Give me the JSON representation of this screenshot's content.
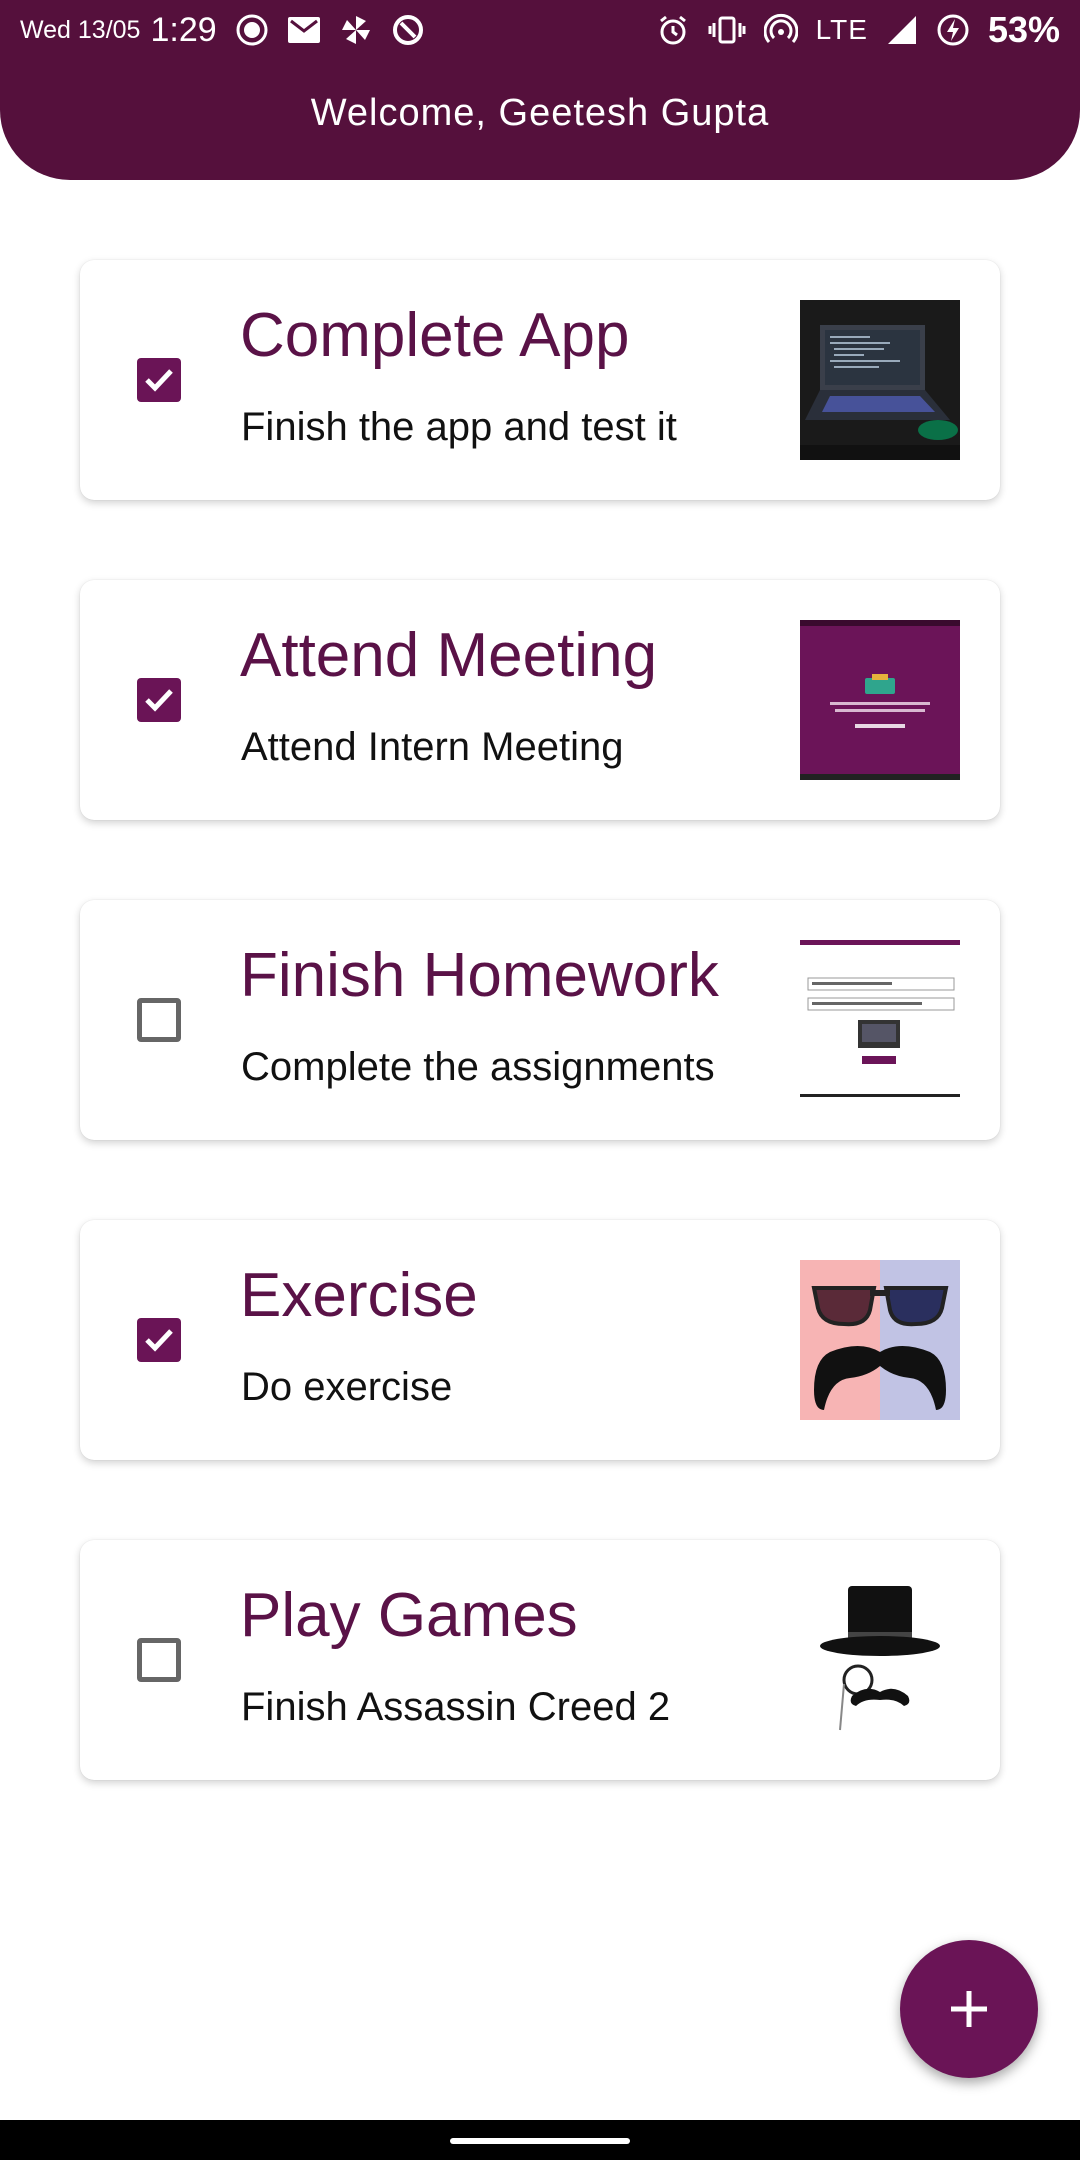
{
  "status_bar": {
    "date": "Wed 13/05",
    "time": "1:29",
    "network": "LTE",
    "battery": "53%",
    "icons_left": [
      "record-icon",
      "gmail-icon",
      "pinwheel-icon",
      "app-icon"
    ],
    "icons_right": [
      "alarm-icon",
      "vibrate-icon",
      "hotspot-icon",
      "signal-icon",
      "battery-saver-icon"
    ]
  },
  "header": {
    "welcome": "Welcome, Geetesh Gupta",
    "color": "#55103c"
  },
  "tasks": [
    {
      "title": "Complete App",
      "description": "Finish the app and test it",
      "checked": true,
      "thumbnail": "laptop-photo"
    },
    {
      "title": "Attend Meeting",
      "description": "Attend Intern Meeting",
      "checked": true,
      "thumbnail": "app-screenshot-purple"
    },
    {
      "title": "Finish Homework",
      "description": "Complete the assignments",
      "checked": false,
      "thumbnail": "app-screenshot-form"
    },
    {
      "title": "Exercise",
      "description": "Do exercise",
      "checked": true,
      "thumbnail": "sunglasses-mustache"
    },
    {
      "title": "Play Games",
      "description": "Finish Assassin Creed 2",
      "checked": false,
      "thumbnail": "top-hat-monocle"
    }
  ],
  "fab": {
    "icon": "plus-icon"
  },
  "colors": {
    "accent": "#6a1456",
    "title_text": "#5a1247"
  }
}
